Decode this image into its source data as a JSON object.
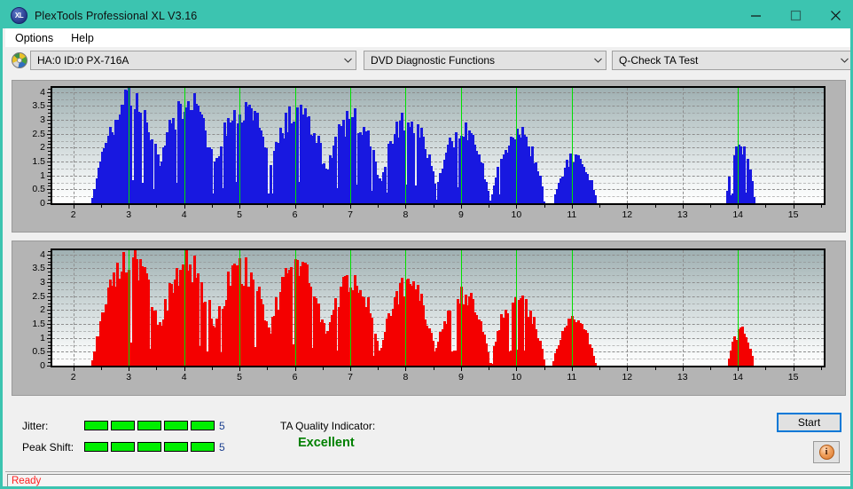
{
  "window": {
    "title": "PlexTools Professional XL V3.16",
    "icon": "disc-xl-icon",
    "logo_text": "XL",
    "controls": {
      "minimize": "minimize-icon",
      "maximize": "maximize-icon",
      "close": "close-icon"
    },
    "accent_color": "#3cc4b0"
  },
  "menubar": {
    "items": [
      "Options",
      "Help"
    ]
  },
  "toolbar": {
    "drive_select": {
      "value": "HA:0 ID:0  PX-716A",
      "icon": "disc-icon"
    },
    "function_select": {
      "value": "DVD Diagnostic Functions"
    },
    "test_select": {
      "value": "Q-Check TA Test"
    }
  },
  "controls": {
    "jitter_label": "Jitter:",
    "jitter_value": "5",
    "jitter_segments": 5,
    "peak_shift_label": "Peak Shift:",
    "peak_shift_value": "5",
    "peak_shift_segments": 5,
    "ta_quality_label": "TA Quality Indicator:",
    "ta_quality_value": "Excellent",
    "ta_quality_color": "#008000",
    "meter_color": "#00ef00",
    "start_button": "Start",
    "info_button": "info-icon",
    "info_glyph": "i"
  },
  "statusbar": {
    "text": "Ready",
    "color": "#ff2020"
  },
  "chart_data": [
    {
      "id": "jitter-chart",
      "type": "bar",
      "title": "",
      "xlabel": "",
      "ylabel": "",
      "series_color": "#1818e0",
      "marker_color": "#00e000",
      "xlim": [
        1.62,
        15.55
      ],
      "ylim": [
        0,
        4.15
      ],
      "yticks": [
        0,
        0.5,
        1,
        1.5,
        2,
        2.5,
        3,
        3.5,
        4
      ],
      "ytick_labels": [
        "0",
        "0.5",
        "1",
        "1.5",
        "2",
        "2.5",
        "3",
        "3.5",
        "4"
      ],
      "xticks": [
        2,
        3,
        4,
        5,
        6,
        7,
        8,
        9,
        10,
        11,
        12,
        13,
        14,
        15
      ],
      "xtick_labels": [
        "2",
        "3",
        "4",
        "5",
        "6",
        "7",
        "8",
        "9",
        "10",
        "11",
        "12",
        "13",
        "14",
        "15"
      ],
      "grid": true,
      "markers": [
        3,
        4,
        5,
        6,
        7,
        8,
        9,
        10,
        11,
        14
      ],
      "peaks": [
        {
          "center": 3.0,
          "amp": 3.75,
          "halfwidth": 0.56
        },
        {
          "center": 4.03,
          "amp": 3.74,
          "halfwidth": 0.5
        },
        {
          "center": 5.03,
          "amp": 3.62,
          "halfwidth": 0.52
        },
        {
          "center": 6.03,
          "amp": 3.47,
          "halfwidth": 0.5
        },
        {
          "center": 7.01,
          "amp": 3.17,
          "halfwidth": 0.47
        },
        {
          "center": 8.02,
          "amp": 3.12,
          "halfwidth": 0.45
        },
        {
          "center": 9.0,
          "amp": 2.63,
          "halfwidth": 0.42
        },
        {
          "center": 10.0,
          "amp": 2.62,
          "halfwidth": 0.4
        },
        {
          "center": 11.04,
          "amp": 1.72,
          "halfwidth": 0.32
        },
        {
          "center": 14.02,
          "amp": 2.2,
          "halfwidth": 0.21
        }
      ]
    },
    {
      "id": "peak-shift-chart",
      "type": "bar",
      "title": "",
      "xlabel": "",
      "ylabel": "",
      "series_color": "#f40000",
      "marker_color": "#00e000",
      "xlim": [
        1.62,
        15.55
      ],
      "ylim": [
        0,
        4.15
      ],
      "yticks": [
        0,
        0.5,
        1,
        1.5,
        2,
        2.5,
        3,
        3.5,
        4
      ],
      "ytick_labels": [
        "0",
        "0.5",
        "1",
        "1.5",
        "2",
        "2.5",
        "3",
        "3.5",
        "4"
      ],
      "xticks": [
        2,
        3,
        4,
        5,
        6,
        7,
        8,
        9,
        10,
        11,
        12,
        13,
        14,
        15
      ],
      "xtick_labels": [
        "2",
        "3",
        "4",
        "5",
        "6",
        "7",
        "8",
        "9",
        "10",
        "11",
        "12",
        "13",
        "14",
        "15"
      ],
      "grid": true,
      "markers": [
        3,
        4,
        5,
        6,
        7,
        8,
        9,
        10,
        11,
        14
      ],
      "peaks": [
        {
          "center": 3.0,
          "amp": 3.8,
          "halfwidth": 0.56
        },
        {
          "center": 4.03,
          "amp": 3.72,
          "halfwidth": 0.5
        },
        {
          "center": 5.02,
          "amp": 3.58,
          "halfwidth": 0.5
        },
        {
          "center": 6.02,
          "amp": 3.58,
          "halfwidth": 0.5
        },
        {
          "center": 7.0,
          "amp": 3.08,
          "halfwidth": 0.46
        },
        {
          "center": 8.02,
          "amp": 2.93,
          "halfwidth": 0.44
        },
        {
          "center": 9.0,
          "amp": 2.62,
          "halfwidth": 0.42
        },
        {
          "center": 10.0,
          "amp": 2.58,
          "halfwidth": 0.4
        },
        {
          "center": 11.02,
          "amp": 1.73,
          "halfwidth": 0.32
        },
        {
          "center": 14.03,
          "amp": 1.28,
          "halfwidth": 0.19
        }
      ]
    }
  ]
}
